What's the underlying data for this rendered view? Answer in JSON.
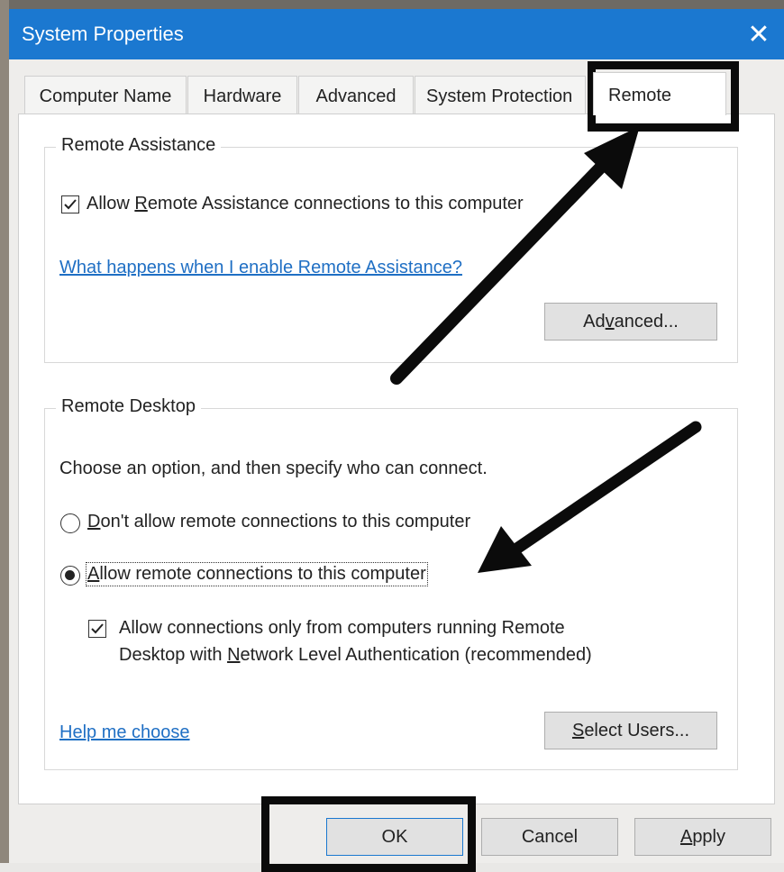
{
  "window": {
    "title": "System Properties",
    "close_glyph": "✕"
  },
  "tabs": [
    {
      "label": "Computer Name"
    },
    {
      "label": "Hardware"
    },
    {
      "label": "Advanced"
    },
    {
      "label": "System Protection"
    },
    {
      "label": "Remote",
      "selected": true
    }
  ],
  "remote_assistance": {
    "legend": "Remote Assistance",
    "allow_checkbox": {
      "pre": "Allow ",
      "mnemonic": "R",
      "post": "emote Assistance connections to this computer",
      "checked": true
    },
    "help_link": "What happens when I enable Remote Assistance?",
    "advanced_button": {
      "pre": "Ad",
      "mnemonic": "v",
      "post": "anced..."
    }
  },
  "remote_desktop": {
    "legend": "Remote Desktop",
    "instruction": "Choose an option, and then specify who can connect.",
    "option_dont": {
      "mnemonic": "D",
      "post": "on't allow remote connections to this computer",
      "selected": false
    },
    "option_allow": {
      "mnemonic": "A",
      "post": "llow remote connections to this computer",
      "selected": true
    },
    "nla_checkbox": {
      "line1": "Allow connections only from computers running Remote",
      "line2_pre": "Desktop with ",
      "line2_mnemonic": "N",
      "line2_post": "etwork Level Authentication (recommended)",
      "checked": true
    },
    "help_link": "Help me choose",
    "select_users_button": {
      "mnemonic": "S",
      "post": "elect Users..."
    }
  },
  "footer": {
    "ok": "OK",
    "cancel": "Cancel",
    "apply_mnemonic": "A",
    "apply_post": "pply"
  },
  "colors": {
    "titlebar": "#1b78d0",
    "link": "#1f6fc4",
    "annotation": "#0b0b0b"
  }
}
